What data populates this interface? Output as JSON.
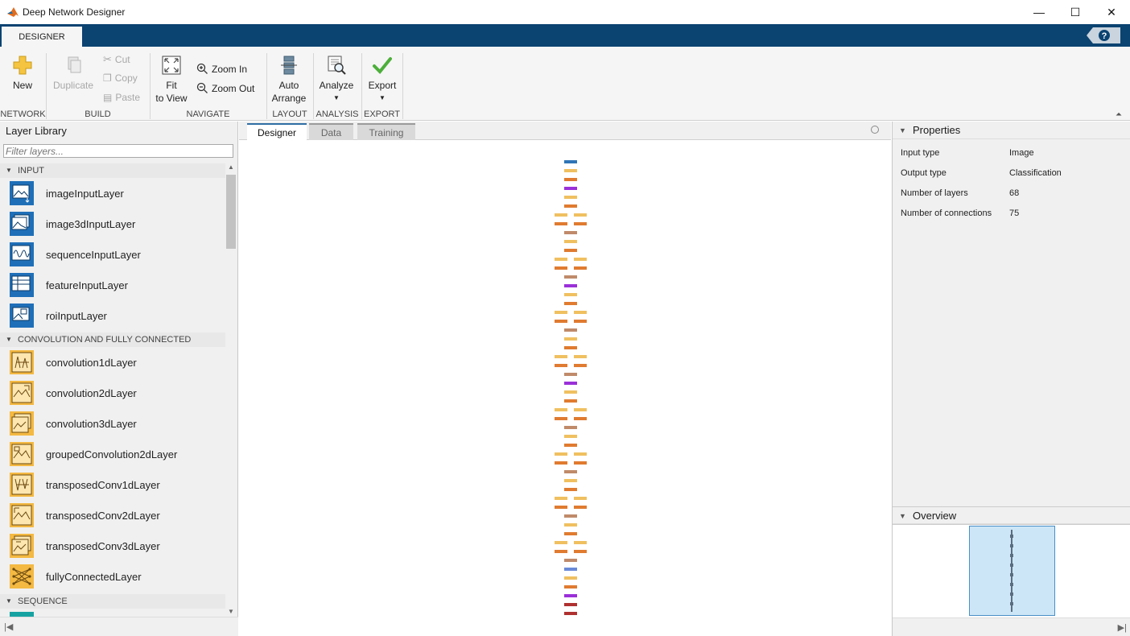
{
  "window": {
    "title": "Deep Network Designer",
    "minimize": "—",
    "maximize": "☐",
    "close": "✕"
  },
  "ribbon_tab": "DESIGNER",
  "help": "?",
  "ribbon": {
    "new": "New",
    "duplicate": "Duplicate",
    "cut": "Cut",
    "copy": "Copy",
    "paste": "Paste",
    "fit_line1": "Fit",
    "fit_line2": "to View",
    "zoom_in": "Zoom In",
    "zoom_out": "Zoom Out",
    "auto_line1": "Auto",
    "auto_line2": "Arrange",
    "analyze": "Analyze",
    "export": "Export",
    "sections": {
      "network": "NETWORK",
      "build": "BUILD",
      "navigate": "NAVIGATE",
      "layout": "LAYOUT",
      "analysis": "ANALYSIS",
      "export": "EXPORT"
    }
  },
  "library": {
    "title": "Layer Library",
    "filter_placeholder": "Filter layers...",
    "categories": [
      {
        "name": "INPUT"
      },
      {
        "name": "CONVOLUTION AND FULLY CONNECTED"
      },
      {
        "name": "SEQUENCE"
      }
    ],
    "input_items": [
      {
        "label": "imageInputLayer"
      },
      {
        "label": "image3dInputLayer"
      },
      {
        "label": "sequenceInputLayer"
      },
      {
        "label": "featureInputLayer"
      },
      {
        "label": "roiInputLayer"
      }
    ],
    "conv_items": [
      {
        "label": "convolution1dLayer"
      },
      {
        "label": "convolution2dLayer"
      },
      {
        "label": "convolution3dLayer"
      },
      {
        "label": "groupedConvolution2dLayer"
      },
      {
        "label": "transposedConv1dLayer"
      },
      {
        "label": "transposedConv2dLayer"
      },
      {
        "label": "transposedConv3dLayer"
      },
      {
        "label": "fullyConnectedLayer"
      }
    ]
  },
  "center_tabs": [
    {
      "label": "Designer",
      "active": true
    },
    {
      "label": "Data",
      "active": false
    },
    {
      "label": "Training",
      "active": false
    }
  ],
  "network_colors": {
    "input": "#2e75b6",
    "conv": "#f0c060",
    "bn": "#e07b30",
    "relu": "#c08a6a",
    "pool": "#9b30d9",
    "fc": "#6a8ad8",
    "output": "#b03030"
  },
  "properties": {
    "title": "Properties",
    "rows": [
      {
        "key": "Input type",
        "value": "Image"
      },
      {
        "key": "Output type",
        "value": "Classification"
      },
      {
        "key": "Number of layers",
        "value": "68"
      },
      {
        "key": "Number of connections",
        "value": "75"
      }
    ]
  },
  "overview": {
    "title": "Overview"
  }
}
